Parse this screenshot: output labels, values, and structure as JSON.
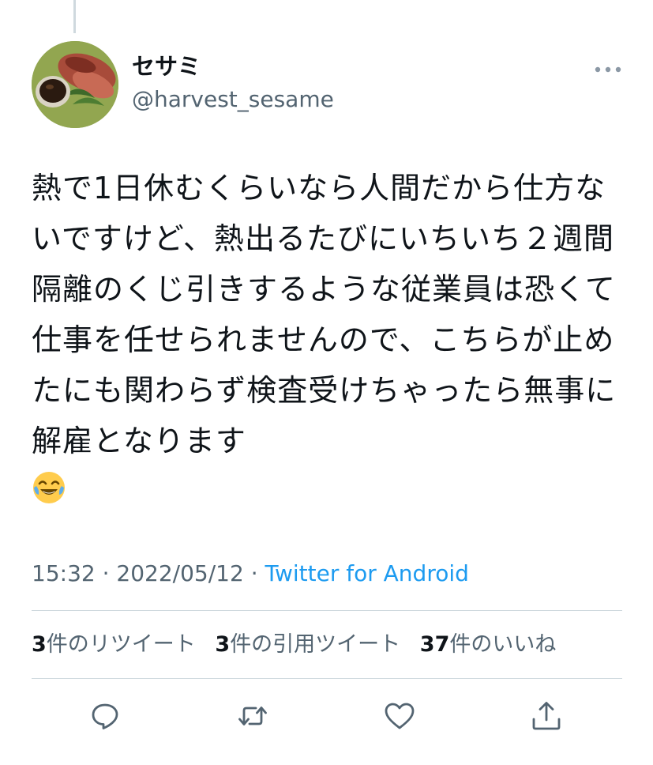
{
  "user": {
    "display_name": "セサミ",
    "handle": "@harvest_sesame"
  },
  "tweet": {
    "text": "熱で1日休むくらいなら人間だから仕方ないですけど、熱出るたびにいちいち２週間隔離のくじ引きするような従業員は恐くて仕事を任せられませんので、こちらが止めたにも関わらず検査受けちゃったら無事に解雇となります",
    "emoji": "face-with-tears-of-joy"
  },
  "meta": {
    "time": "15:32",
    "date": "2022/05/12",
    "separator": " · ",
    "source": "Twitter for Android"
  },
  "stats": {
    "retweets_count": "3",
    "retweets_label": "件のリツイート",
    "quotes_count": "3",
    "quotes_label": "件の引用ツイート",
    "likes_count": "37",
    "likes_label": "件のいいね"
  },
  "icons": {
    "more": "more-horizontal-icon",
    "reply": "reply-icon",
    "retweet": "retweet-icon",
    "like": "heart-icon",
    "share": "share-icon"
  },
  "colors": {
    "text": "#0f1419",
    "secondary": "#536471",
    "accent": "#1d9bf0",
    "divider": "#cfd9de"
  }
}
